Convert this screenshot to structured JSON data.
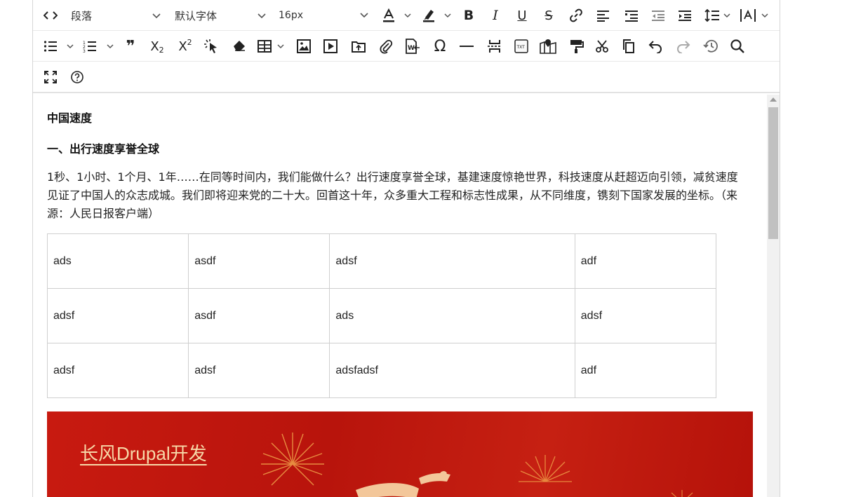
{
  "toolbar": {
    "paragraph_format": "段落",
    "font_family": "默认字体",
    "font_size": "16px",
    "bold": "B",
    "italic": "I",
    "underline": "U",
    "strikethrough": "S",
    "subscript_base": "X",
    "subscript_mark": "2",
    "superscript_base": "X",
    "superscript_mark": "2",
    "quote": "❞",
    "special_char": "Ω",
    "txt_label": "TXT"
  },
  "content": {
    "heading1": "中国速度",
    "heading2": "一、出行速度享誉全球",
    "paragraph": "1秒、1小时、1个月、1年……在同等时间内，我们能做什么？出行速度享誉全球，基建速度惊艳世界，科技速度从赶超迈向引领，减贫速度见证了中国人的众志成城。我们即将迎来党的二十大。回首这十年，众多重大工程和标志性成果，从不同维度，镌刻下国家发展的坐标。（来源：人民日报客户端）",
    "table": [
      [
        "ads",
        "asdf",
        "adsf",
        "adf"
      ],
      [
        "adsf",
        "asdf",
        "ads",
        "adsf"
      ],
      [
        "adsf",
        "adsf",
        "adsfadsf",
        "adf"
      ]
    ],
    "banner_text": "长风Drupal开发"
  },
  "colors": {
    "accent_red": "#c81a10",
    "banner_text": "#f7d8a8"
  }
}
